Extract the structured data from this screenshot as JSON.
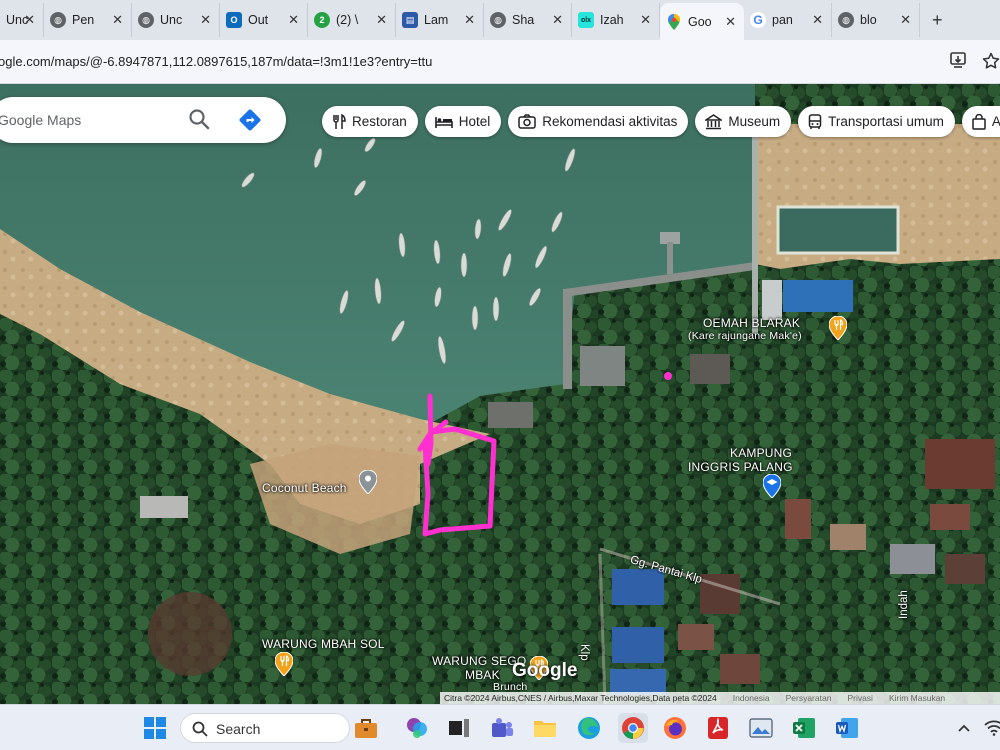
{
  "browser": {
    "tabs": [
      {
        "title": "Unc",
        "favicon": "globe-icon"
      },
      {
        "title": "Pen",
        "favicon": "globe-icon"
      },
      {
        "title": "Unc",
        "favicon": "globe-icon"
      },
      {
        "title": "Out",
        "favicon": "outlook-icon"
      },
      {
        "title": "(2) \\",
        "favicon": "whatsapp-icon"
      },
      {
        "title": "Lam",
        "favicon": "document-icon"
      },
      {
        "title": "Sha",
        "favicon": "globe-icon"
      },
      {
        "title": "Izah",
        "favicon": "olx-icon"
      },
      {
        "title": "Goo",
        "favicon": "maps-pin-icon",
        "active": true
      },
      {
        "title": "pan",
        "favicon": "google-icon"
      },
      {
        "title": "blo",
        "favicon": "globe-icon"
      }
    ],
    "close_glyph": "✕",
    "new_tab_glyph": "+",
    "url": "ogle.com/maps/@-6.8947871,112.0897615,187m/data=!3m1!1e3?entry=ttu"
  },
  "maps": {
    "search_placeholder": "Google Maps",
    "chips": [
      {
        "label": "Restoran",
        "icon": "fork-knife-icon"
      },
      {
        "label": "Hotel",
        "icon": "bed-icon"
      },
      {
        "label": "Rekomendasi aktivitas",
        "icon": "camera-icon"
      },
      {
        "label": "Museum",
        "icon": "museum-icon"
      },
      {
        "label": "Transportasi umum",
        "icon": "bus-icon"
      },
      {
        "label": "A",
        "icon": "bag-icon"
      }
    ],
    "places": {
      "oemah_blarak": "OEMAH BLARAK",
      "oemah_blarak_sub": "(Kare rajungane Mak'e)",
      "kampung_inggris_1": "KAMPUNG",
      "kampung_inggris_2": "INGGRIS PALANG",
      "coconut_beach": "Coconut Beach",
      "warung_mbah_sol": "WARUNG MBAH SOL",
      "warung_sego_1": "WARUNG SEGO",
      "warung_sego_2": "MBAK",
      "warung_sego_3": "Brunch"
    },
    "streets": {
      "gg_pantai": "Gg. Pantai Klp",
      "klp_vertical": "Klp",
      "indah_vertical": "Indah"
    },
    "google_logo": "Google",
    "attribution": "Citra ©2024 Airbus,CNES / Airbus,Maxar Technologies,Data peta ©2024",
    "attribution_links": [
      "Indonesia",
      "Persyaratan",
      "Privasi",
      "Kirim Masukan"
    ],
    "colors": {
      "water": "#3f7a6a",
      "vegetation": "#1f3d24",
      "sand": "#c9b38a",
      "annotation": "#ff2fd0",
      "place_pin": "#f2a31b",
      "school_pin": "#1a73e8"
    }
  },
  "taskbar": {
    "search_label": "Search"
  }
}
